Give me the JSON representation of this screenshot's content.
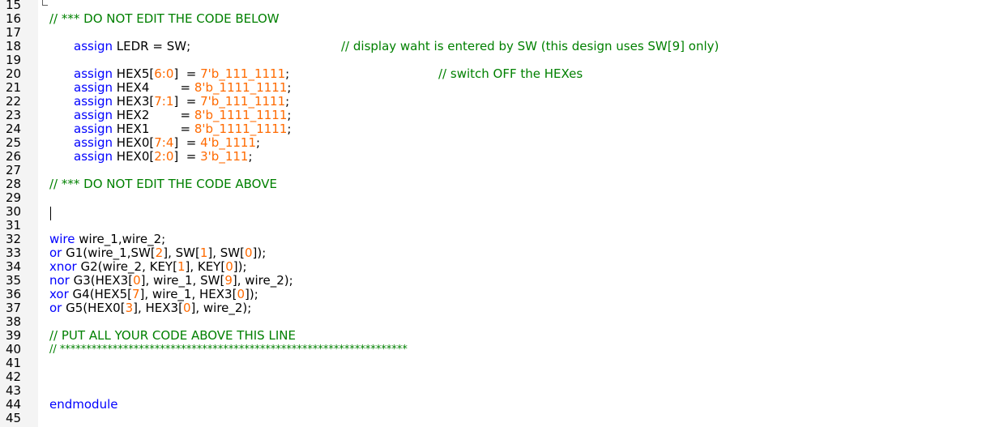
{
  "line_numbers": [
    "15",
    "16",
    "17",
    "18",
    "19",
    "20",
    "21",
    "22",
    "23",
    "24",
    "25",
    "26",
    "27",
    "28",
    "29",
    "30",
    "31",
    "32",
    "33",
    "34",
    "35",
    "36",
    "37",
    "38",
    "39",
    "40",
    "41",
    "42",
    "43",
    "44",
    "45"
  ],
  "code": {
    "l16": "// *** DO NOT EDIT THE CODE BELOW",
    "l18_kw": "assign",
    "l18_text": " LEDR = SW;",
    "l18_comment": "// display waht is entered by SW (this design uses SW[9] only)",
    "l20_kw": "assign",
    "l20_a": " HEX5[",
    "l20_n1": "6",
    "l20_c": ":",
    "l20_n2": "0",
    "l20_b": "]  = ",
    "l20_val": "7'b_111_1111",
    "l20_end": ";",
    "l20_comment": "// switch OFF the HEXes",
    "l21_kw": "assign",
    "l21_a": " HEX4        = ",
    "l21_val": "8'b_1111_1111",
    "l21_end": ";",
    "l22_kw": "assign",
    "l22_a": " HEX3[",
    "l22_n1": "7",
    "l22_c": ":",
    "l22_n2": "1",
    "l22_b": "]  = ",
    "l22_val": "7'b_111_1111",
    "l22_end": ";",
    "l23_kw": "assign",
    "l23_a": " HEX2        = ",
    "l23_val": "8'b_1111_1111",
    "l23_end": ";",
    "l24_kw": "assign",
    "l24_a": " HEX1        = ",
    "l24_val": "8'b_1111_1111",
    "l24_end": ";",
    "l25_kw": "assign",
    "l25_a": " HEX0[",
    "l25_n1": "7",
    "l25_c": ":",
    "l25_n2": "4",
    "l25_b": "]  = ",
    "l25_val": "4'b_1111",
    "l25_end": ";",
    "l26_kw": "assign",
    "l26_a": " HEX0[",
    "l26_n1": "2",
    "l26_c": ":",
    "l26_n2": "0",
    "l26_b": "]  = ",
    "l26_val": "3'b_111",
    "l26_end": ";",
    "l28": "// *** DO NOT EDIT THE CODE ABOVE",
    "l32_kw": "wire",
    "l32_text": " wire_1,wire_2;",
    "l33_kw": "or",
    "l33_a": " G1(wire_1,SW[",
    "l33_n1": "2",
    "l33_b": "], SW[",
    "l33_n2": "1",
    "l33_c": "], SW[",
    "l33_n3": "0",
    "l33_d": "]);",
    "l34_kw": "xnor",
    "l34_a": " G2(wire_2, KEY[",
    "l34_n1": "1",
    "l34_b": "], KEY[",
    "l34_n2": "0",
    "l34_c": "]);",
    "l35_kw": "nor",
    "l35_a": " G3(HEX3[",
    "l35_n1": "0",
    "l35_b": "], wire_1, SW[",
    "l35_n2": "9",
    "l35_c": "], wire_2);",
    "l36_kw": "xor",
    "l36_a": " G4(HEX5[",
    "l36_n1": "7",
    "l36_b": "], wire_1, HEX3[",
    "l36_n2": "0",
    "l36_c": "]);",
    "l37_kw": "or",
    "l37_a": " G5(HEX0[",
    "l37_n1": "3",
    "l37_b": "], HEX3[",
    "l37_n2": "0",
    "l37_c": "], wire_2);",
    "l39": "// PUT ALL YOUR CODE ABOVE THIS LINE",
    "l40": "// ******************************************************************",
    "l44_kw": "endmodule"
  },
  "colors": {
    "keyword": "#0000ff",
    "number": "#ff6a00",
    "comment": "#008000",
    "gutter": "#f4f4f4"
  }
}
